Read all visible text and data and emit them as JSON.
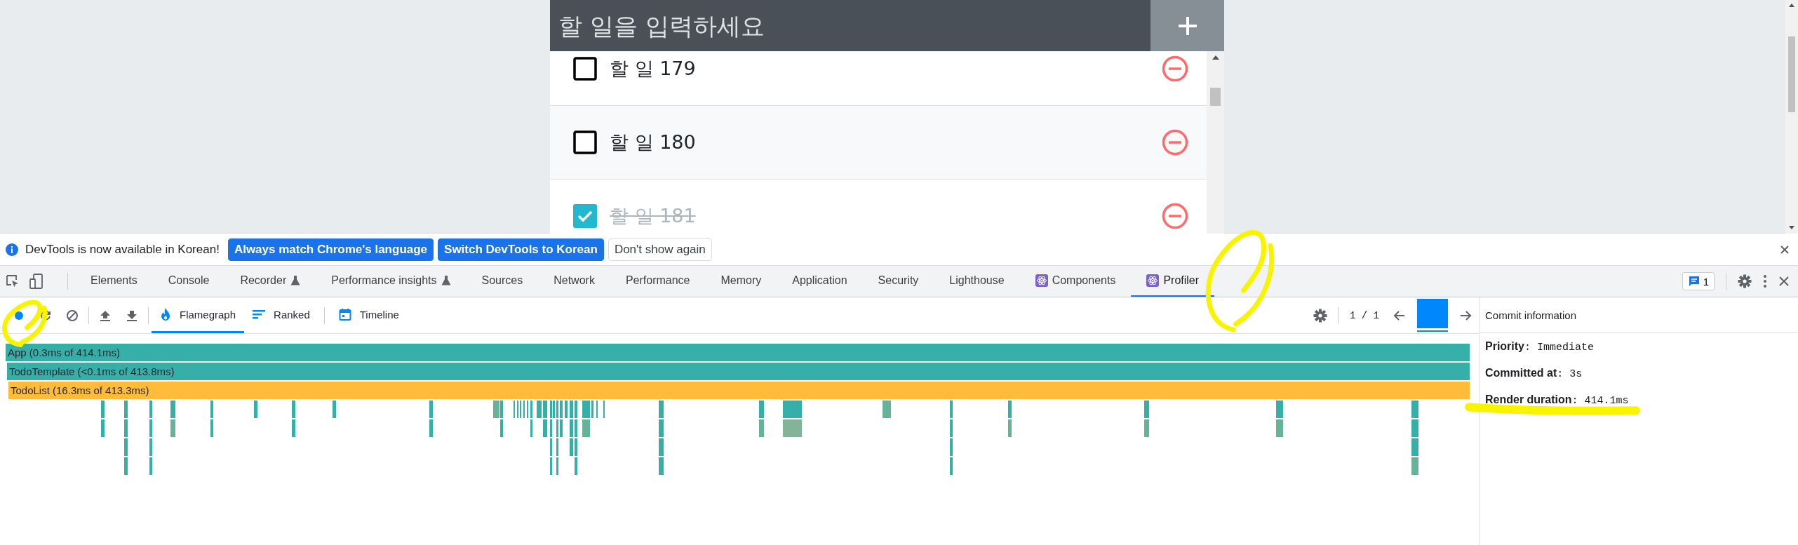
{
  "todo_app": {
    "input": {
      "placeholder": "할 일을 입력하세요"
    },
    "todos": [
      {
        "text": "할 일 179",
        "checked": false
      },
      {
        "text": "할 일 180",
        "checked": false
      },
      {
        "text": "할 일 181",
        "checked": true
      }
    ]
  },
  "infobar": {
    "message": "DevTools is now available in Korean!",
    "buttons": [
      {
        "label": "Always match Chrome's language",
        "kind": "primary"
      },
      {
        "label": "Switch DevTools to Korean",
        "kind": "primary"
      },
      {
        "label": "Don't show again",
        "kind": "secondary"
      }
    ]
  },
  "devtools_tabs": [
    {
      "label": "Elements",
      "selected": false,
      "kind": "plain"
    },
    {
      "label": "Console",
      "selected": false,
      "kind": "plain"
    },
    {
      "label": "Recorder",
      "selected": false,
      "kind": "experimental"
    },
    {
      "label": "Performance insights",
      "selected": false,
      "kind": "experimental"
    },
    {
      "label": "Sources",
      "selected": false,
      "kind": "plain"
    },
    {
      "label": "Network",
      "selected": false,
      "kind": "plain"
    },
    {
      "label": "Performance",
      "selected": false,
      "kind": "plain"
    },
    {
      "label": "Memory",
      "selected": false,
      "kind": "plain"
    },
    {
      "label": "Application",
      "selected": false,
      "kind": "plain"
    },
    {
      "label": "Security",
      "selected": false,
      "kind": "plain"
    },
    {
      "label": "Lighthouse",
      "selected": false,
      "kind": "plain"
    },
    {
      "label": "Components",
      "selected": false,
      "kind": "react"
    },
    {
      "label": "Profiler",
      "selected": true,
      "kind": "react"
    }
  ],
  "issues_badge": "1",
  "profiler": {
    "views": [
      {
        "label": "Flamegraph",
        "selected": true,
        "kind": "flame"
      },
      {
        "label": "Ranked",
        "selected": false,
        "kind": "ranked"
      },
      {
        "label": "Timeline",
        "selected": false,
        "kind": "timeline"
      }
    ],
    "commit_counter": "1 / 1"
  },
  "flamegraph": {
    "bars": [
      {
        "label": "App (0.3ms of 414.1ms)",
        "color": "#37afa9",
        "children": [
          {
            "label": "TodoTemplate (<0.1ms of 413.8ms)",
            "color": "#37afa9",
            "children": [
              {
                "label": "TodoList (16.3ms of 413.3ms)",
                "color": "#ffbc3a"
              }
            ]
          }
        ]
      }
    ]
  },
  "commit_info": {
    "title": "Commit information",
    "items": [
      "**Priority**: Immediate",
      "**Committed at**: 3s",
      "**Render duration**: 414.1ms"
    ]
  },
  "annotations": [
    {
      "kind": "loop"
    },
    {
      "kind": "loop"
    },
    {
      "kind": "underline"
    }
  ]
}
